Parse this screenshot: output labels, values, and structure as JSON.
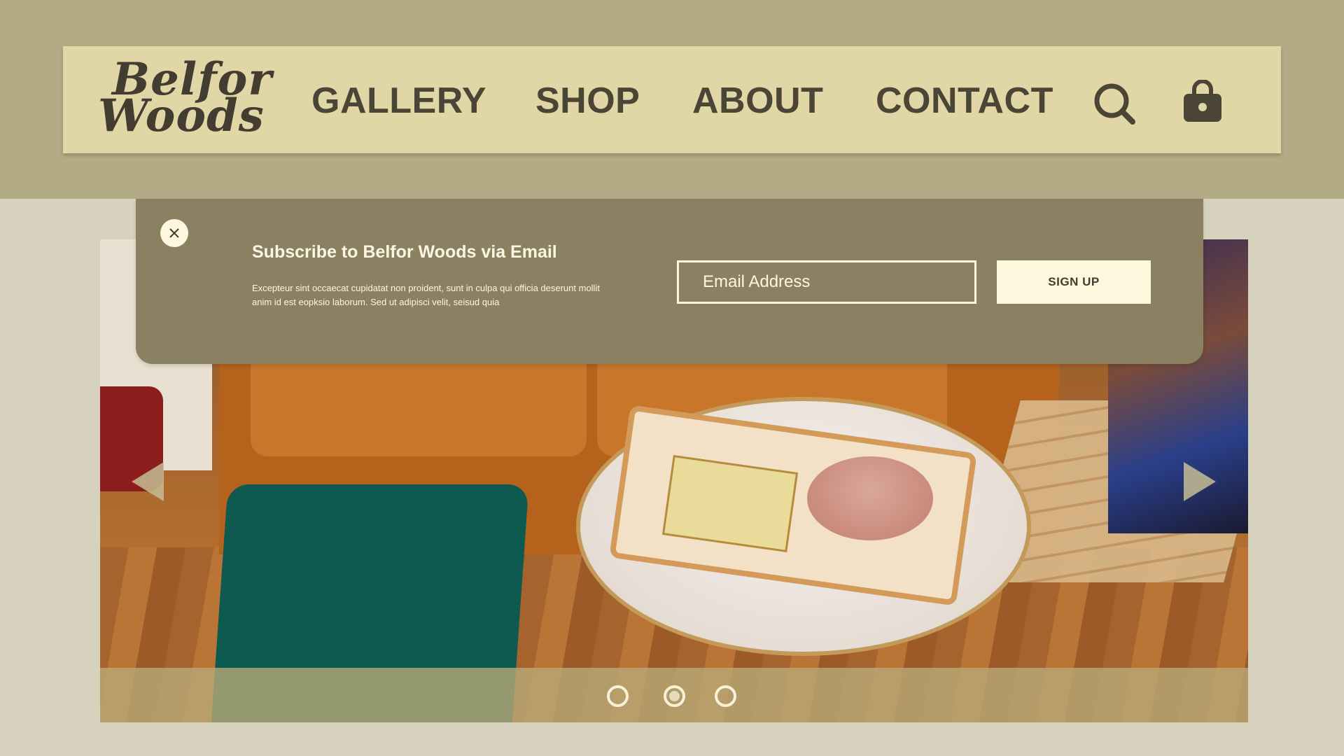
{
  "brand": {
    "line1": "Belfor",
    "line2": "Woods"
  },
  "nav": {
    "gallery": "GALLERY",
    "shop": "SHOP",
    "about": "ABOUT",
    "contact": "CONTACT",
    "search_icon": "search-icon",
    "bag_icon": "shopping-bag-icon"
  },
  "subscribe": {
    "title": "Subscribe to Belfor Woods via Email",
    "body": "Excepteur sint occaecat cupidatat non proident, sunt in culpa qui officia deserunt mollit anim id est eopksio laborum. Sed ut adipisci velit, seisud quia",
    "email_placeholder": "Email Address",
    "signup_label": "SIGN UP",
    "close_icon": "close-icon"
  },
  "carousel": {
    "slide_count": 3,
    "active_index": 2,
    "prev_icon": "triangle-left-icon",
    "next_icon": "triangle-right-icon"
  },
  "colors": {
    "header_band": "#b2ab85",
    "navbar": "#e0d6a6",
    "modal": "#8b8162",
    "page_bg": "#d6d2bd",
    "button_bg": "#fdf8dd",
    "text_dark": "#423c31"
  }
}
